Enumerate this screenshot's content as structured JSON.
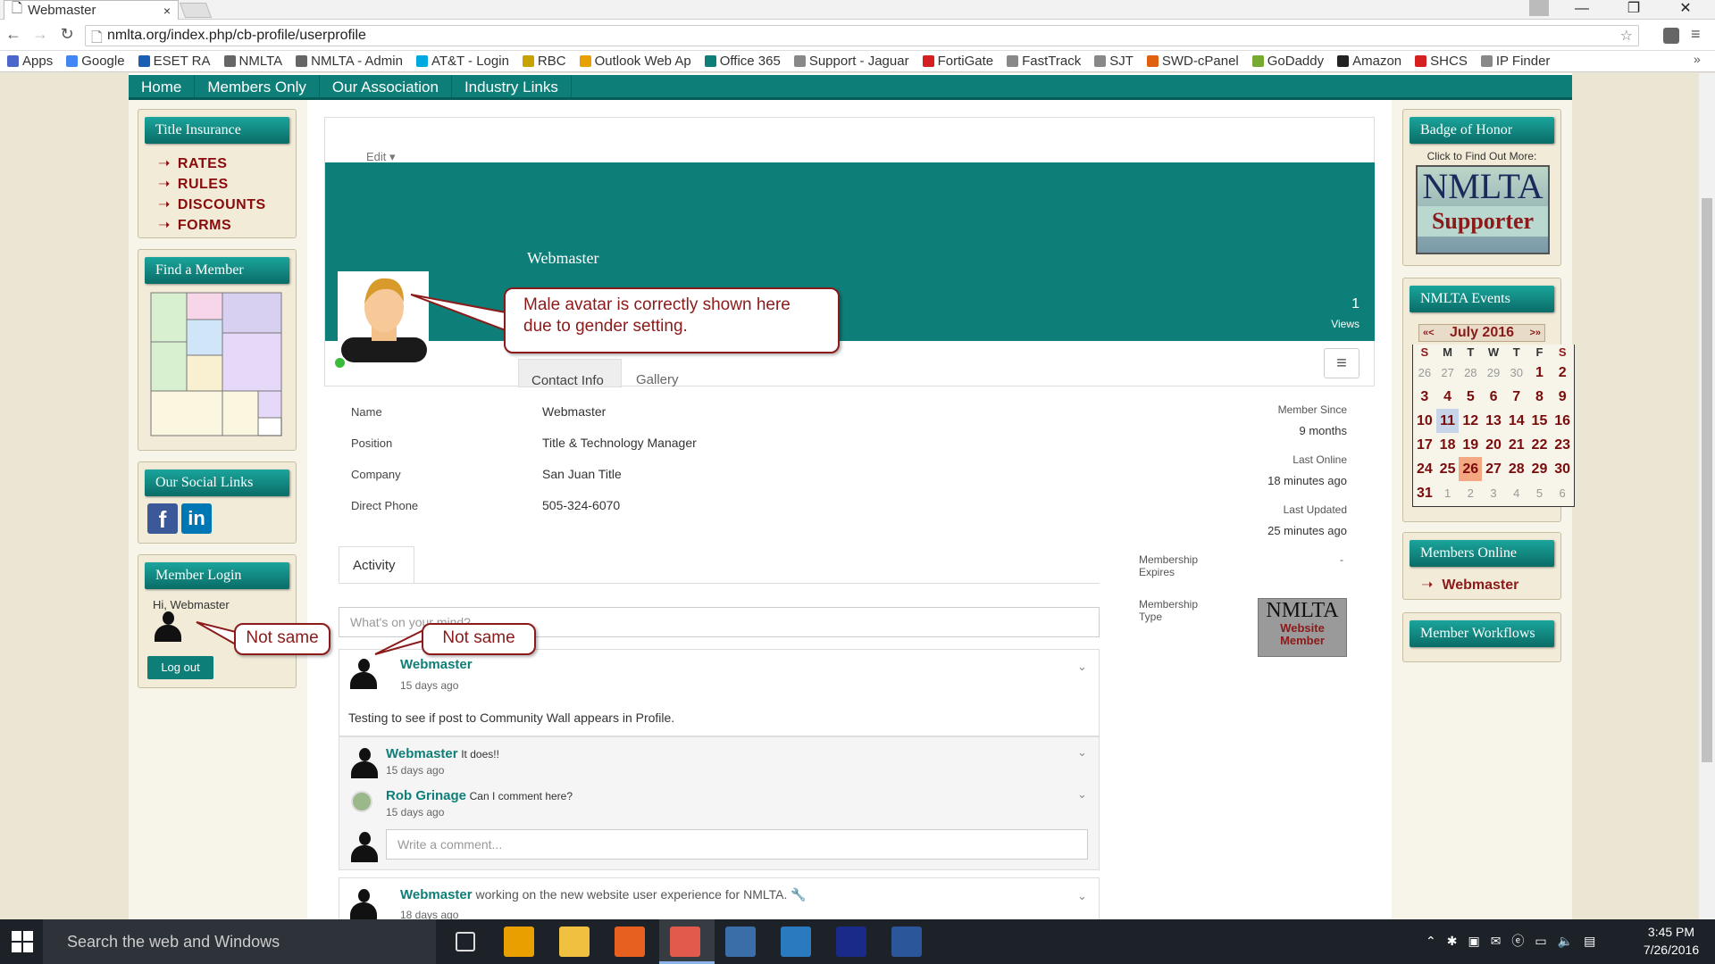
{
  "browser": {
    "tab_title": "Webmaster",
    "tab_close": "×",
    "url": "nmlta.org/index.php/cb-profile/userprofile",
    "window_buttons": [
      "—",
      "❐",
      "✕"
    ],
    "nav_icons": [
      "back-icon",
      "forward-icon",
      "reload-icon"
    ],
    "bookmarks": [
      {
        "label": "Apps",
        "color": "#4a67c9"
      },
      {
        "label": "Google",
        "color": "#4285f4"
      },
      {
        "label": "ESET RA",
        "color": "#1a5fb4"
      },
      {
        "label": "NMLTA",
        "color": "#666666"
      },
      {
        "label": "NMLTA - Admin",
        "color": "#666666"
      },
      {
        "label": "AT&T - Login",
        "color": "#00a8e0"
      },
      {
        "label": "RBC",
        "color": "#c8a200"
      },
      {
        "label": "Outlook Web Ap",
        "color": "#e8a000"
      },
      {
        "label": "Office 365",
        "color": "#0e7e78"
      },
      {
        "label": "Support - Jaguar",
        "color": "#888888"
      },
      {
        "label": "FortiGate",
        "color": "#d42020"
      },
      {
        "label": "FastTrack",
        "color": "#888888"
      },
      {
        "label": "SJT",
        "color": "#888888"
      },
      {
        "label": "SWD-cPanel",
        "color": "#e06010"
      },
      {
        "label": "GoDaddy",
        "color": "#77aa33"
      },
      {
        "label": "Amazon",
        "color": "#222222"
      },
      {
        "label": "SHCS",
        "color": "#d42020"
      },
      {
        "label": "IP Finder",
        "color": "#888888"
      }
    ]
  },
  "site": {
    "nav": [
      "Home",
      "Members Only",
      "Our Association",
      "Industry Links"
    ],
    "left": {
      "title_insurance": "Title Insurance",
      "ti_links": [
        "RATES",
        "RULES",
        "DISCOUNTS",
        "FORMS"
      ],
      "find_member": "Find a Member",
      "social": "Our Social Links",
      "member_login": "Member Login",
      "greeting": "Hi, Webmaster",
      "logout": "Log out"
    },
    "right": {
      "badge_title": "Badge of Honor",
      "badge_caption": "Click to Find Out More:",
      "badge_word1": "NMLTA",
      "badge_word2": "Supporter",
      "events_title": "NMLTA Events",
      "cal_month": "July 2016",
      "cal_prev": "«<",
      "cal_next": ">»",
      "cal_days": [
        "S",
        "M",
        "T",
        "W",
        "T",
        "F",
        "S"
      ],
      "cal_weeks": [
        [
          "26",
          "27",
          "28",
          "29",
          "30",
          "1",
          "2"
        ],
        [
          "3",
          "4",
          "5",
          "6",
          "7",
          "8",
          "9"
        ],
        [
          "10",
          "11",
          "12",
          "13",
          "14",
          "15",
          "16"
        ],
        [
          "17",
          "18",
          "19",
          "20",
          "21",
          "22",
          "23"
        ],
        [
          "24",
          "25",
          "26",
          "27",
          "28",
          "29",
          "30"
        ],
        [
          "31",
          "1",
          "2",
          "3",
          "4",
          "5",
          "6"
        ]
      ],
      "members_online": "Members Online",
      "online_user": "Webmaster",
      "workflows": "Member Workflows"
    },
    "profile": {
      "edit": "Edit ▾",
      "name_heading": "Webmaster",
      "views_count": "1",
      "views_label": "Views",
      "tabs": [
        "Contact Info",
        "Gallery"
      ],
      "fields": [
        {
          "label": "Name",
          "value": "Webmaster"
        },
        {
          "label": "Position",
          "value": "Title & Technology Manager"
        },
        {
          "label": "Company",
          "value": "San Juan Title"
        },
        {
          "label": "Direct Phone",
          "value": "505-324-6070"
        }
      ],
      "meta": [
        {
          "label": "Member Since",
          "value": "9 months"
        },
        {
          "label": "Last Online",
          "value": "18 minutes ago"
        },
        {
          "label": "Last Updated",
          "value": "25 minutes ago"
        }
      ],
      "expires_label": "Membership Expires",
      "expires_value": "-",
      "type_label": "Membership Type",
      "type_badge1": "NMLTA",
      "type_badge2": "Website Member",
      "activity_tab": "Activity",
      "status_placeholder": "What's on your mind?",
      "posts": [
        {
          "user": "Webmaster",
          "time": "15 days ago",
          "text": "Testing to see if post to Community Wall appears in Profile."
        }
      ],
      "comments": [
        {
          "user": "Webmaster",
          "text": "It does!!",
          "time": "15 days ago"
        },
        {
          "user": "Rob Grinage",
          "text": "Can I comment here?",
          "time": "15 days ago"
        }
      ],
      "comment_placeholder": "Write a comment...",
      "post2_user": "Webmaster",
      "post2_text": "working on the new website user experience for NMLTA.",
      "post2_time": "18 days ago"
    },
    "callouts": {
      "avatar": "Male avatar is correctly shown here due to gender setting.",
      "not_same_1": "Not same",
      "not_same_2": "Not same"
    }
  },
  "taskbar": {
    "search": "Search the web and Windows",
    "time": "3:45 PM",
    "date": "7/26/2016",
    "apps": [
      {
        "name": "task-view-icon",
        "color": "#1c2228"
      },
      {
        "name": "outlook-icon",
        "color": "#e8a000"
      },
      {
        "name": "file-explorer-icon",
        "color": "#f0c040"
      },
      {
        "name": "firefox-icon",
        "color": "#e86020"
      },
      {
        "name": "chrome-icon",
        "color": "#dd4433"
      },
      {
        "name": "thunderbird-icon",
        "color": "#3a6ea8"
      },
      {
        "name": "app-t-icon",
        "color": "#2a7ac0"
      },
      {
        "name": "app-nm-icon",
        "color": "#1a2a88"
      },
      {
        "name": "word-icon",
        "color": "#2b579a"
      }
    ]
  }
}
